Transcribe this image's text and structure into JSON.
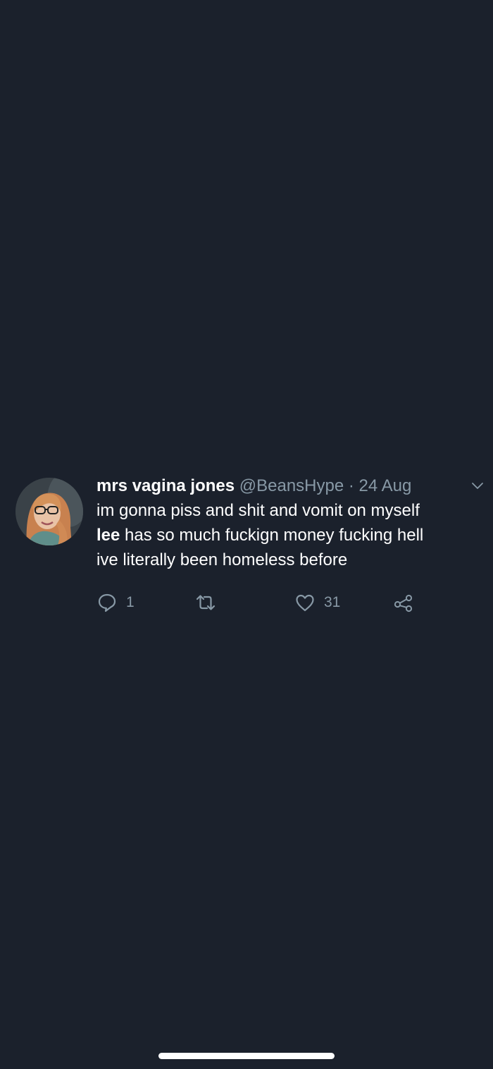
{
  "tweet": {
    "display_name": "mrs vagina jones",
    "handle": "@BeansHype",
    "separator": "·",
    "date": "24 Aug",
    "text_line1": "im gonna piss and shit and vomit on myself",
    "mention": "lee",
    "text_line2_rest": " has so much fuckign money fucking hell",
    "text_line3": "ive literally been homeless before",
    "actions": {
      "reply_icon": "reply-icon",
      "reply_count": "1",
      "retweet_icon": "retweet-icon",
      "retweet_count": "",
      "like_icon": "heart-icon",
      "like_count": "31",
      "share_icon": "share-icon"
    }
  },
  "colors": {
    "background": "#1b212c",
    "primary_text": "#ffffff",
    "secondary_text": "#8899a6"
  }
}
